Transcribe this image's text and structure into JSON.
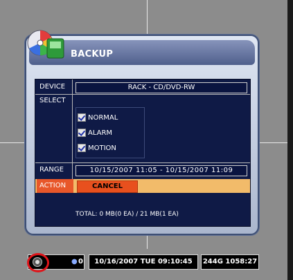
{
  "dialog": {
    "title": "BACKUP",
    "labels": {
      "device": "DEVICE",
      "select": "SELECT",
      "range": "RANGE",
      "action": "ACTION"
    },
    "device_value": "RACK - CD/DVD-RW",
    "options": [
      {
        "label": "NORMAL",
        "checked": true
      },
      {
        "label": "ALARM",
        "checked": true
      },
      {
        "label": "MOTION",
        "checked": true
      }
    ],
    "range_value": "10/15/2007 11:05 - 10/15/2007 11:09",
    "cancel_label": "CANCEL",
    "total_text": "TOTAL:    0 MB(0 EA)  /  21 MB(1 EA)"
  },
  "statusbar": {
    "count": "0",
    "datetime": "10/16/2007 TUE 09:10:45",
    "storage": "244G  1058:27"
  },
  "colors": {
    "background": "#8c8c8c",
    "panel_bg": "#0f1a46",
    "action_highlight": "#f2bb6a",
    "action_label": "#e8572a",
    "title_bar": "#4f5f8c",
    "highlight_ring": "#e0141a"
  }
}
